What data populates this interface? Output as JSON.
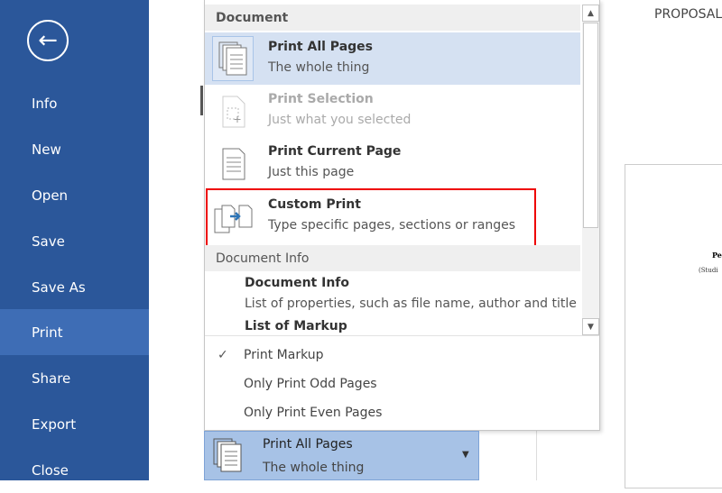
{
  "sidebar": {
    "items": [
      {
        "label": "Info"
      },
      {
        "label": "New"
      },
      {
        "label": "Open"
      },
      {
        "label": "Save"
      },
      {
        "label": "Save As"
      },
      {
        "label": "Print",
        "selected": true
      },
      {
        "label": "Share"
      },
      {
        "label": "Export"
      },
      {
        "label": "Close"
      }
    ],
    "color": "#2b579a"
  },
  "menu": {
    "doc_header": "Document",
    "items": [
      {
        "title": "Print All Pages",
        "subtitle": "The whole thing",
        "icon": "pages-stack-icon"
      },
      {
        "title": "Print Selection",
        "subtitle": "Just what you selected",
        "icon": "selection-page-icon",
        "disabled": true
      },
      {
        "title": "Print Current Page",
        "subtitle": "Just this page",
        "icon": "single-page-icon"
      },
      {
        "title": "Custom Print",
        "subtitle": "Type specific pages, sections or ranges",
        "icon": "custom-print-icon"
      }
    ],
    "info_header": "Document Info",
    "info_items": [
      {
        "title": "Document Info",
        "subtitle": "List of properties, such as file name, author and title"
      },
      {
        "title": "List of Markup"
      }
    ],
    "options": [
      {
        "label": "Print Markup",
        "checked": true
      },
      {
        "label": "Only Print Odd Pages"
      },
      {
        "label": "Only Print Even Pages"
      }
    ]
  },
  "print_button": {
    "title": "Print All Pages",
    "subtitle": "The whole thing"
  },
  "preview": {
    "heading": "PROPOSAL",
    "page_line1": "Pe",
    "page_line2": "(Studi"
  },
  "highlight_color": "#e00000"
}
